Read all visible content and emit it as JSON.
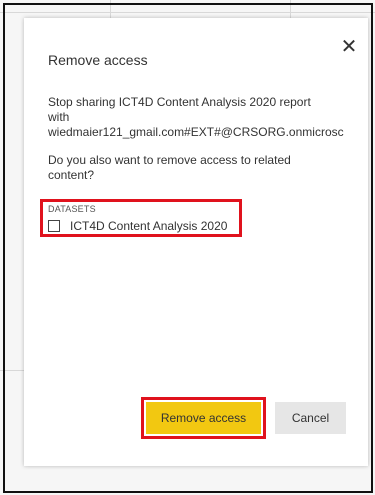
{
  "dialog": {
    "title": "Remove access",
    "close_icon": "close-icon",
    "message_line1": "Stop sharing ICT4D Content Analysis 2020 report",
    "message_line2": "with",
    "message_line3": "wiedmaier121_gmail.com#EXT#@CRSORG.onmicrosc",
    "question_line1": "Do you also want to remove access to related",
    "question_line2": "content?",
    "datasets_header": "DATASETS",
    "dataset_item": "ICT4D Content Analysis 2020",
    "dataset_checked": false
  },
  "buttons": {
    "remove_label": "Remove access",
    "cancel_label": "Cancel"
  },
  "colors": {
    "primary_button": "#f2c811",
    "secondary_button": "#e6e6e6",
    "highlight_border": "#e0121d"
  }
}
